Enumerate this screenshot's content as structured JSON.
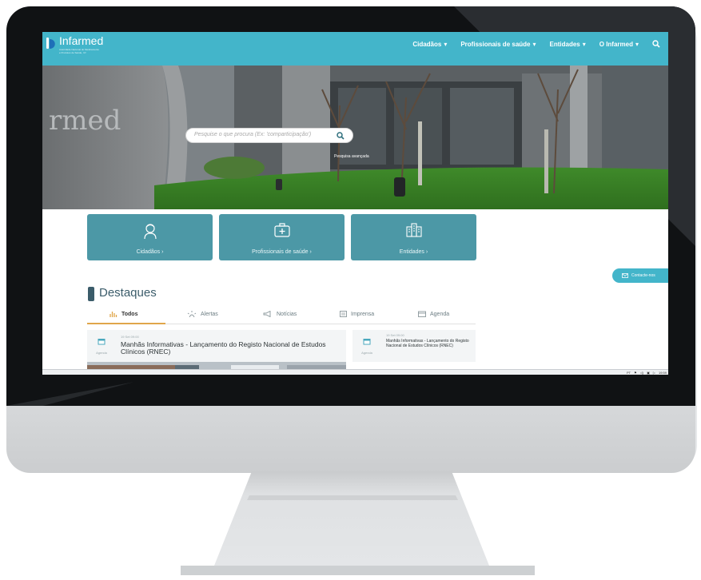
{
  "brand": {
    "title": "Infarmed",
    "subtitle": "Autoridade Nacional do Medicamento e Produtos de Saúde, I.P."
  },
  "nav": {
    "items": [
      "Cidadãos",
      "Profissionais de saúde",
      "Entidades",
      "O Infarmed"
    ],
    "search_icon": "search-icon"
  },
  "search": {
    "placeholder": "Pesquise o que procura (Ex: 'comparticipação')",
    "advanced": "Pesquisa avançada"
  },
  "hero": {
    "sign_text": "rmed"
  },
  "categories": [
    {
      "label": "Cidadãos ›",
      "icon": "person-icon"
    },
    {
      "label": "Profissionais de saúde ›",
      "icon": "medical-kit-icon"
    },
    {
      "label": "Entidades ›",
      "icon": "buildings-icon"
    }
  ],
  "contact": {
    "label": "Contacte-nos",
    "icon": "envelope-icon"
  },
  "highlights": {
    "title": "Destaques",
    "tabs": [
      "Todos",
      "Alertas",
      "Notícias",
      "Imprensa",
      "Agenda"
    ],
    "active_tab": "Todos"
  },
  "news": {
    "main": {
      "date": "19 Set 09:00",
      "category": "Agenda",
      "title": "Manhãs Informativas - Lançamento do Registo Nacional de Estudos Clínicos (RNEC)"
    },
    "side": {
      "date": "19 Set 09:00",
      "category": "Agenda",
      "title": "Manhãs Informativas - Lançamento do Registo Nacional de Estudos Clínicos (RNEC)"
    }
  },
  "taskbar": {
    "lang": "PT",
    "time": "19:59"
  },
  "colors": {
    "nav_bg": "#43b5ca",
    "card_bg": "#4c98a6",
    "title": "#3b5c6a",
    "accent_tab": "#e0a64a",
    "bezel": "#101214"
  }
}
